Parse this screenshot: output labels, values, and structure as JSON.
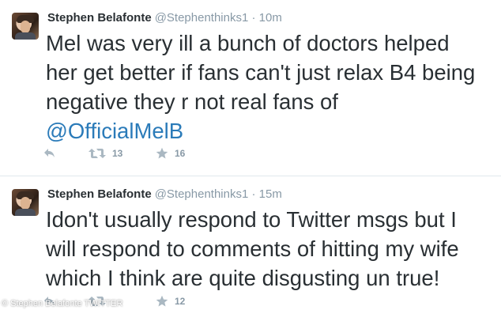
{
  "tweets": [
    {
      "fullname": "Stephen Belafonte",
      "username": "@Stephenthinks1",
      "separator": "·",
      "time": "10m",
      "text_lines": [
        "Mel was very ill a bunch of doctors helped",
        "her get better if fans can't just relax B4 being",
        "negative they r not real fans of"
      ],
      "mention": "@OfficialMelB",
      "retweets": "13",
      "favorites": "16"
    },
    {
      "fullname": "Stephen Belafonte",
      "username": "@Stephenthinks1",
      "separator": "·",
      "time": "15m",
      "text_lines": [
        "Idon't usually respond to Twitter msgs but I",
        "will respond to comments of hitting my wife",
        "which I think are quite disgusting un true!"
      ],
      "retweets": "",
      "favorites": "12"
    }
  ],
  "photo_credit": "© Stephen Belafonte TWITTER",
  "colors": {
    "text": "#292f33",
    "muted": "#8899a6",
    "link": "#2b7bb9",
    "divider": "#e1e8ed"
  },
  "icons": [
    "reply-icon",
    "retweet-icon",
    "favorite-icon"
  ]
}
